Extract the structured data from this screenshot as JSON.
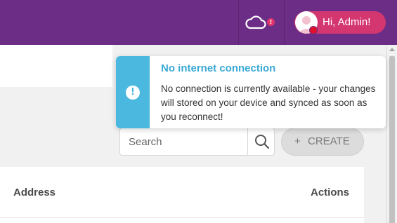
{
  "header": {
    "user_greeting": "Hi, Admin!",
    "sync_alert": "!"
  },
  "toast": {
    "title": "No internet connection",
    "message": "No connection is currently available - your changes will stored on your device and synced as soon as you reconnect!",
    "icon": "!"
  },
  "toolbar": {
    "search_placeholder": "Search",
    "create_plus": "+",
    "create_label": "CREATE"
  },
  "table": {
    "columns": [
      "Address",
      "Actions"
    ]
  },
  "colors": {
    "header_bg": "#6b2d86",
    "user_pill_bg": "#d43670",
    "toast_accent": "#4bb8e0",
    "toast_title": "#3aa9d6"
  },
  "icons": {
    "sync": "cloud-icon",
    "search": "search-icon",
    "toast": "info-icon"
  }
}
